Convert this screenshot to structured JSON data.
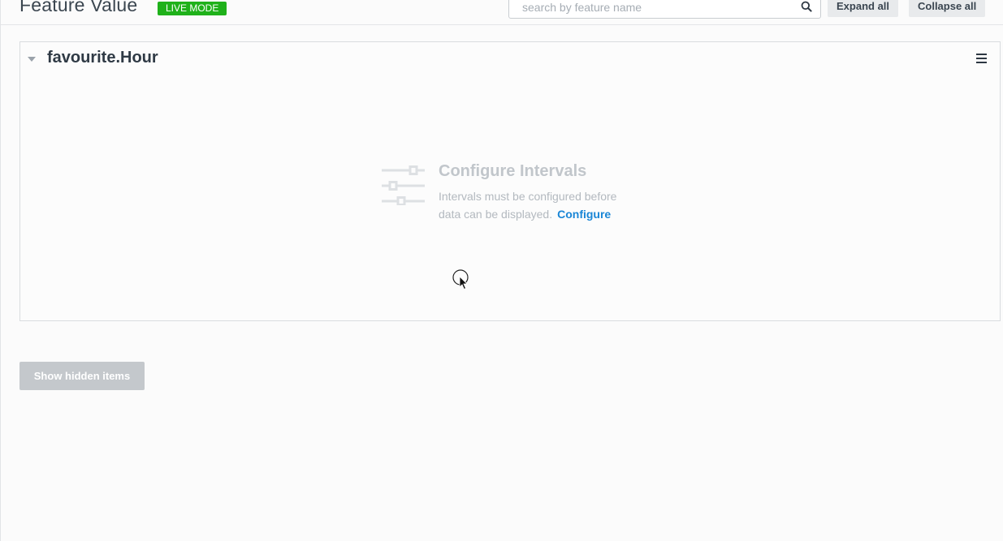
{
  "header": {
    "title": "Feature Value",
    "mode_badge": "LIVE MODE",
    "search_placeholder": "search by feature name",
    "expand_label": "Expand all",
    "collapse_label": "Collapse all"
  },
  "panel": {
    "title": "favourite.Hour",
    "empty_state": {
      "heading": "Configure Intervals",
      "message_line1": "Intervals must be configured before",
      "message_line2": "data can be displayed.",
      "link_label": "Configure"
    }
  },
  "footer": {
    "show_hidden_label": "Show hidden items"
  },
  "colors": {
    "live_badge": "#1fb11a",
    "link": "#1a86d6",
    "muted_text": "#b3b9bf"
  },
  "icons": [
    "search-icon",
    "caret-down-icon",
    "hamburger-menu-icon",
    "sliders-icon",
    "mouse-cursor-icon"
  ]
}
